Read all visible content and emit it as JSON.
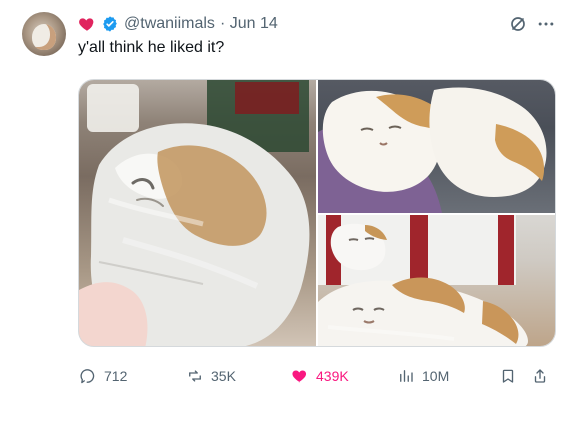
{
  "tweet": {
    "handle": "@twaniimals",
    "date": "· Jun 14",
    "text": "y'all think he liked it?"
  },
  "actions": {
    "reply_count": "712",
    "repost_count": "35K",
    "like_count": "439K",
    "views_count": "10M"
  },
  "icons": {
    "heart_badge": "heart-icon",
    "verified_badge": "verified-icon",
    "grok": "grok-icon",
    "more": "more-icon",
    "reply": "reply-icon",
    "repost": "repost-icon",
    "like": "like-icon",
    "views": "views-icon",
    "bookmark": "bookmark-icon",
    "share": "share-icon"
  },
  "colors": {
    "text_primary": "#0f1419",
    "text_secondary": "#536471",
    "like_active": "#f91880",
    "verified_blue": "#1d9bf0",
    "heart_red": "#e0245e"
  }
}
